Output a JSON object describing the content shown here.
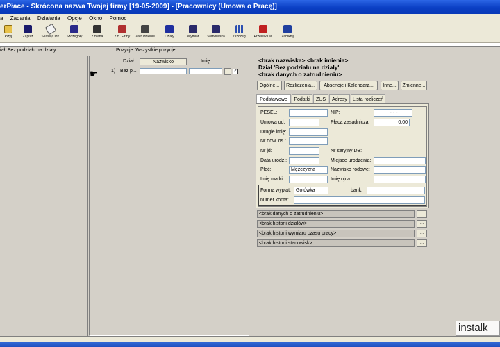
{
  "window": {
    "title": "erPłace - Skrócona nazwa Twojej firmy [19-05-2009] - [Pracownicy (Umowa o Pracę)]"
  },
  "menu": [
    "a",
    "Zadania",
    "Działania",
    "Opcje",
    "Okno",
    "Pomoc"
  ],
  "toolbar": [
    {
      "label": "łożyj",
      "icon": "folder-icon"
    },
    {
      "label": "Zapisz",
      "icon": "save-icon"
    },
    {
      "label": "Skasuj/Odk.",
      "icon": "eraser-icon"
    },
    {
      "label": "Szczegóły",
      "icon": "details-icon"
    },
    {
      "label": "Zmiana",
      "icon": "edit-icon"
    },
    {
      "label": "Zm. Firmy",
      "icon": "company-icon"
    },
    {
      "label": "Zatrudnienie",
      "icon": "employment-icon"
    },
    {
      "label": "Działy",
      "icon": "departments-icon"
    },
    {
      "label": "Wymiar",
      "icon": "dimension-icon"
    },
    {
      "label": "Stanowiska",
      "icon": "positions-icon"
    },
    {
      "label": "Zszczeg.",
      "icon": "grid-icon"
    },
    {
      "label": "Przelew Dla",
      "icon": "transfer-icon"
    },
    {
      "label": "Zamknij",
      "icon": "close-icon"
    }
  ],
  "filters": {
    "dept_filter": "iał:  Bez podziału na działy",
    "positions_filter": "Pozycje: Wszystkie pozycje"
  },
  "list": {
    "headers": {
      "dept": "Dział",
      "surname": "Nazwisko",
      "firstname": "Imię"
    },
    "rows": [
      {
        "num": "1)",
        "dept": "Bez p...",
        "ellipsis": "...",
        "checked": "✓"
      }
    ]
  },
  "detail": {
    "name_line": "<brak nazwiska> <brak imienia>",
    "dept_line": "Dział 'Bez podziału na działy'",
    "employment_line": "<brak danych o zatrudnieniu>",
    "buttons": [
      "Ogólne...",
      "Rozliczenia...",
      "Absencje i Kalendarz...",
      "Inne...",
      "Zmienne..."
    ],
    "tabs": [
      "Podstawowe",
      "Podatki",
      "ZUS",
      "Adresy",
      "Lista rozliczeń"
    ],
    "fields": {
      "pesel": "PESEL:",
      "nip": "NIP:",
      "nip_value": "-  -  -",
      "umowa_od": "Umowa od:",
      "placa": "Płaca zasadnicza:",
      "placa_value": "0,00",
      "drugie_imie": "Drugie imię:",
      "nr_dow": "Nr dow. os.:",
      "nr_jd": "Nr jd:",
      "nr_seryjny": "Nr seryjny DB:",
      "data_urodz": "Data urodz.:",
      "miejsce_ur": "Miejsce urodzenia:",
      "plec": "Płeć:",
      "plec_value": "Mężczyzna",
      "nazwisko_rod": "Nazwisko rodowe:",
      "imie_matki": "Imię matki:",
      "imie_ojca": "Imię ojca:",
      "forma_wyplat": "Forma wypłat:",
      "forma_value": "Gotówka",
      "bank": "bank:",
      "numer_konta": "numer konta:"
    },
    "history": [
      "<brak danych o zatrudnieniu>",
      "<brak historii działów>",
      "<brak historii wymiaru czasu pracy>",
      "<brak historii stanowisk>"
    ],
    "history_btn": "..."
  },
  "watermark": "instalk"
}
